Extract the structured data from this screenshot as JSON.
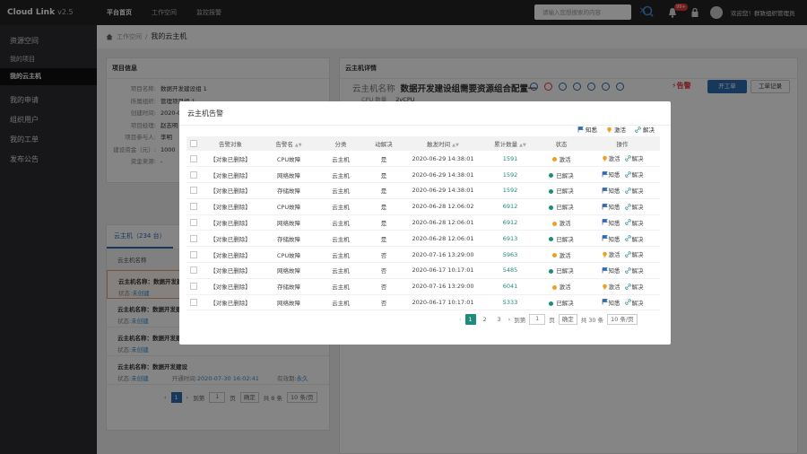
{
  "topbar": {
    "logo": "Cloud Link",
    "version": "v2.5",
    "nav": [
      "平台首页",
      "工作空间",
      "监控报警"
    ],
    "search_placeholder": "请输入您想搜索的内容",
    "badge": "99+",
    "user": "欢迎您！群致组织管理员"
  },
  "sidebar": {
    "section1": "资源空间",
    "sub1": "我的项目",
    "sub2": "我的云主机",
    "items": [
      "我的申请",
      "组织用户",
      "我的工单",
      "发布公告"
    ]
  },
  "breadcrumb": {
    "home": "工作空间",
    "sep": "/",
    "current": "我的云主机"
  },
  "project_info": {
    "title": "项目信息",
    "rows": [
      {
        "k": "项目名称:",
        "v": "数据开发建设组 1"
      },
      {
        "k": "所属组织:",
        "v": "管理项目组 1"
      },
      {
        "k": "创建时间:",
        "v": "2020-0"
      },
      {
        "k": "项目经理:",
        "v": "赵志明"
      },
      {
        "k": "项目参与人:",
        "v": "李明"
      },
      {
        "k": "建设资金（元）:",
        "v": "1000"
      },
      {
        "k": "资金来源:",
        "v": "-"
      }
    ]
  },
  "vm_list": {
    "title": "云主机（234 台）",
    "col": "云主机名称",
    "cards": [
      {
        "name": "云主机名称：数据开发建设",
        "status_k": "状态:",
        "status_v": "未创建"
      },
      {
        "name": "云主机名称：数据开发建设",
        "status_k": "状态:",
        "status_v": "未创建"
      },
      {
        "name": "云主机名称：数据开发建设",
        "status_k": "状态:",
        "status_v": "未创建"
      },
      {
        "name": "云主机名称：数据开发建设",
        "status_k": "状态:",
        "status_v": "未创建",
        "open_k": "开通时间:",
        "open_v": "2020-07-30 16:02:41",
        "valid_k": "有效期:",
        "valid_v": "永久"
      }
    ],
    "pager": {
      "page": "1",
      "goto": "到第",
      "page_no": "1",
      "page_unit": "页",
      "ok": "确定",
      "total": "共 8 条",
      "size": "10 条/页"
    }
  },
  "detail": {
    "title": "云主机详情",
    "name_key": "云主机名称",
    "name_val": "数据开发建设组需要资源组合配置一",
    "cpu_k": "CPU 数量",
    "cpu_v": "2vCPU",
    "alarm": "告警",
    "btn_primary": "开工单",
    "btn_default": "工单记录"
  },
  "modal": {
    "title": "云主机告警",
    "actions": [
      "知悉",
      "激活",
      "解决"
    ],
    "headers": [
      "告警对象",
      "告警名",
      "分类",
      "动解决",
      "触发时间",
      "累计数量",
      "状态",
      "操作"
    ],
    "rows": [
      [
        "【对象已删除】",
        "CPU故障",
        "云主机",
        "是",
        "2020-06-29 14:38:01",
        "1591",
        "激活"
      ],
      [
        "【对象已删除】",
        "网络故障",
        "云主机",
        "是",
        "2020-06-29 14:38:01",
        "1592",
        "已解决"
      ],
      [
        "【对象已删除】",
        "存储故障",
        "云主机",
        "是",
        "2020-06-29 14:38:01",
        "1592",
        "已解决"
      ],
      [
        "【对象已删除】",
        "CPU故障",
        "云主机",
        "是",
        "2020-06-28 12:06:02",
        "6912",
        "已解决"
      ],
      [
        "【对象已删除】",
        "网络故障",
        "云主机",
        "是",
        "2020-06-28 12:06:01",
        "6912",
        "激活"
      ],
      [
        "【对象已删除】",
        "存储故障",
        "云主机",
        "是",
        "2020-06-28 12:06:01",
        "6913",
        "已解决"
      ],
      [
        "【对象已删除】",
        "CPU故障",
        "云主机",
        "否",
        "2020-07-16 13:29:00",
        "5963",
        "激活"
      ],
      [
        "【对象已删除】",
        "网络故障",
        "云主机",
        "否",
        "2020-06-17 10:17:01",
        "5485",
        "已解决"
      ],
      [
        "【对象已删除】",
        "存储故障",
        "云主机",
        "否",
        "2020-07-16 13:29:00",
        "6041",
        "激活"
      ],
      [
        "【对象已删除】",
        "网络故障",
        "云主机",
        "否",
        "2020-06-17 10:17:01",
        "5333",
        "已解决"
      ]
    ],
    "row_icons": [
      "bulb",
      "flag",
      "flag",
      "flag",
      "flag",
      "flag",
      "bulb",
      "flag",
      "bulb",
      "flag"
    ],
    "pager": {
      "pages": [
        "1",
        "2",
        "3"
      ],
      "goto": "到第",
      "page_no": "1",
      "page_unit": "页",
      "ok": "确定",
      "total": "共 30 条",
      "size": "10 条/页"
    }
  },
  "colors": {
    "accent": "#2d6bb3",
    "teal": "#1f8b7a",
    "orange": "#f0a020",
    "alarm": "#e4393c"
  }
}
